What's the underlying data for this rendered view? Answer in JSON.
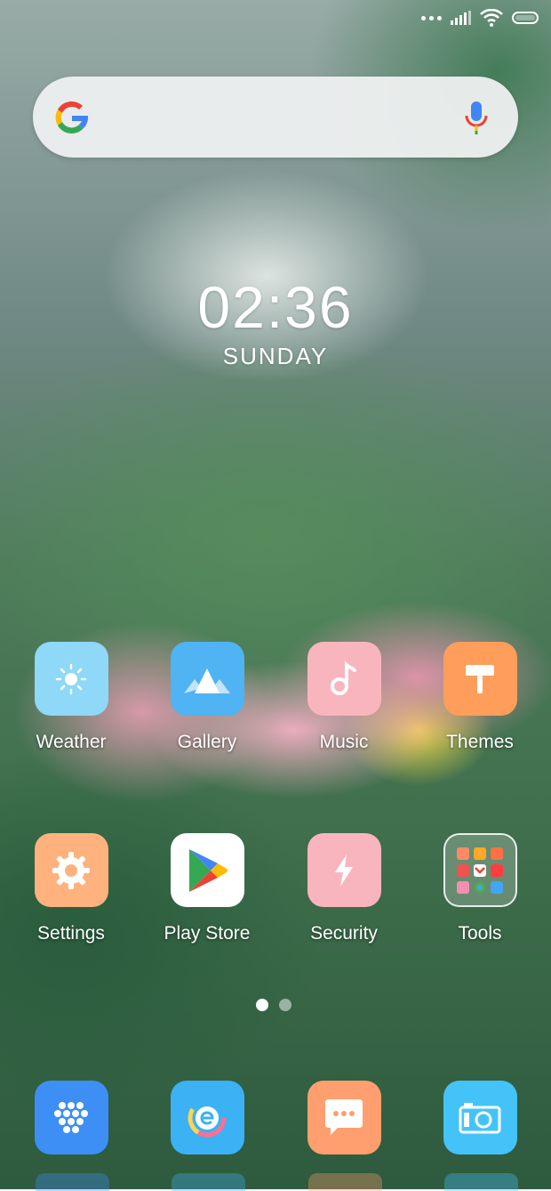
{
  "clock": {
    "time": "02:36",
    "day": "SUNDAY"
  },
  "search": {
    "logo": "google-g-icon",
    "mic": "microphone-icon"
  },
  "apps_row1": [
    {
      "label": "Weather",
      "icon": "sun-icon",
      "color": "#8fd8f7"
    },
    {
      "label": "Gallery",
      "icon": "mountain-icon",
      "color": "#4fb3f4"
    },
    {
      "label": "Music",
      "icon": "music-note-icon",
      "color": "#f9b5bd"
    },
    {
      "label": "Themes",
      "icon": "paint-roller-icon",
      "color": "#ff9e5a"
    }
  ],
  "apps_row2": [
    {
      "label": "Settings",
      "icon": "gear-icon",
      "color": "#ffb27e"
    },
    {
      "label": "Play Store",
      "icon": "play-store-icon",
      "color": "#ffffff"
    },
    {
      "label": "Security",
      "icon": "lightning-icon",
      "color": "#f9b5bd"
    },
    {
      "label": "Tools",
      "icon": "folder-icon",
      "color": "rgba(255,255,255,0.25)"
    }
  ],
  "dock": [
    {
      "icon": "honeycomb-icon",
      "color": "#3d8ff5"
    },
    {
      "icon": "browser-e-icon",
      "color": "#3cb1f4"
    },
    {
      "icon": "message-bubble-icon",
      "color": "#ff9e6e"
    },
    {
      "icon": "camera-icon",
      "color": "#44c3f8"
    }
  ],
  "pager": {
    "active_color": "#ffffff",
    "inactive_color": "rgba(255,255,255,0.5)"
  }
}
